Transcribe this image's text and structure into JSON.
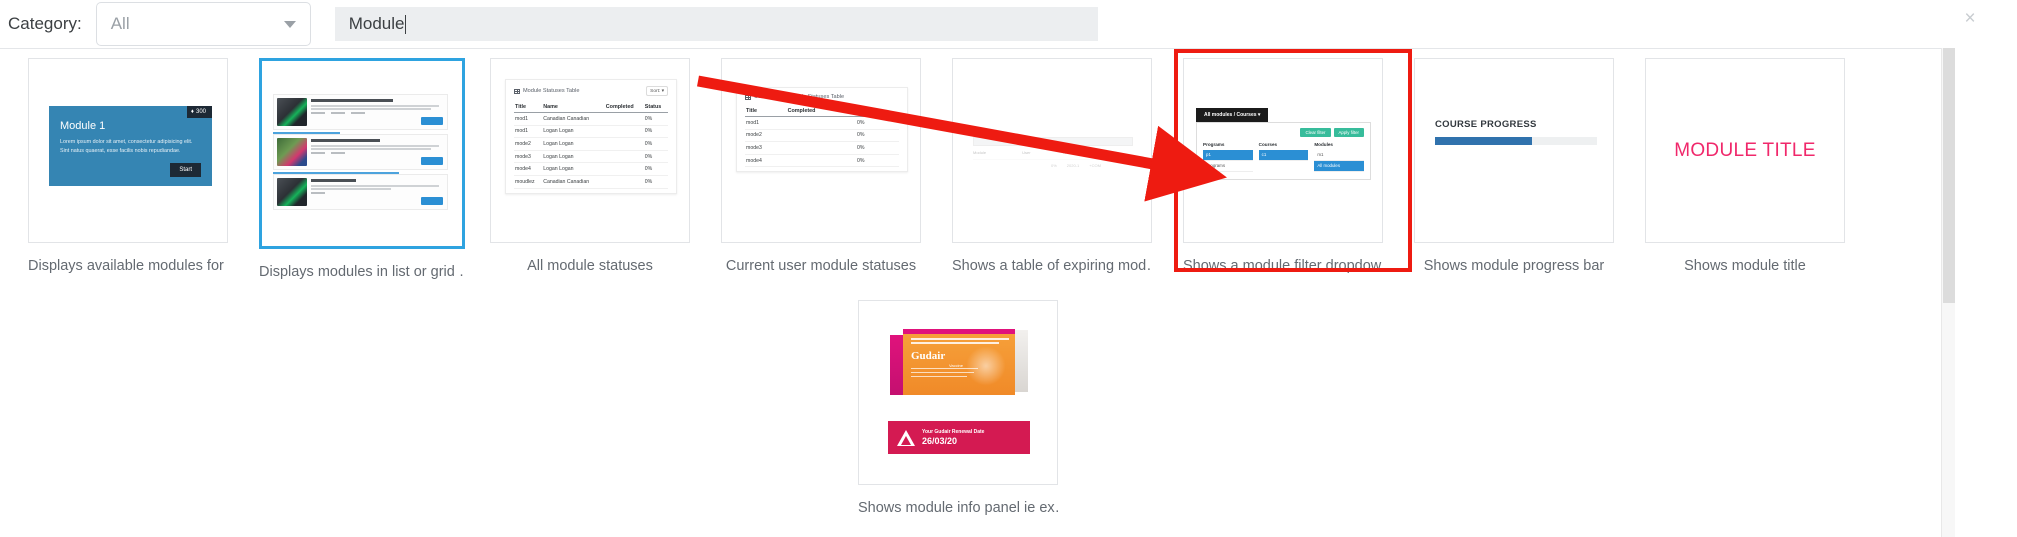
{
  "filter_bar": {
    "category_label": "Category:",
    "category_value": "All",
    "category_options": [
      "All"
    ],
    "search_value": "Module",
    "search_placeholder": "",
    "close_label": "×",
    "caret_icon": "chevron-down-icon"
  },
  "cards": [
    {
      "id": "available-modules",
      "caption": "Displays available modules for …",
      "selected": false,
      "highlighted": false,
      "preview": {
        "kind": "module-hero",
        "title": "Module 1",
        "badge": "300",
        "badge_icon": "gem-icon",
        "body": "Lorem ipsum dolor sit amet, consectetur adipisicing elit. Sint natus quaerat, esse facilis nobis repudiandae.",
        "button": "Start",
        "accent": "#3585b3"
      }
    },
    {
      "id": "modules-list-grid",
      "caption": "Displays modules in list or grid …",
      "selected": true,
      "highlighted": false,
      "preview": {
        "kind": "module-list",
        "items": [
          {
            "title": "My module is really awesome and you know it",
            "progress": 38,
            "button": "Start"
          },
          {
            "title": "My module is really awesome and you",
            "progress": 0,
            "button": "Resume"
          },
          {
            "title": "My module is really",
            "progress": 72,
            "button": "Resume"
          }
        ]
      }
    },
    {
      "id": "all-module-statuses",
      "caption": "All module statuses",
      "selected": false,
      "highlighted": false,
      "preview": {
        "kind": "table",
        "title": "Module Statuses Table",
        "title_icon": "table-icon",
        "sort_label": "Sort: ▾",
        "columns": [
          "Title",
          "Name",
          "Completed",
          "Status"
        ],
        "rows": [
          [
            "mod1",
            "Canadian Canadian",
            "",
            "0%"
          ],
          [
            "mod1",
            "Logan Logan",
            "",
            "0%"
          ],
          [
            "mode2",
            "Logan Logan",
            "",
            "0%"
          ],
          [
            "mode3",
            "Logan Logan",
            "",
            "0%"
          ],
          [
            "mode4",
            "Logan Logan",
            "",
            "0%"
          ],
          [
            "moudlez",
            "Canadian Canadian",
            "",
            "0%"
          ]
        ]
      }
    },
    {
      "id": "current-user-module-statuses",
      "caption": "Current user module statuses",
      "selected": false,
      "highlighted": false,
      "preview": {
        "kind": "table",
        "title": "Current User Module Statuses Table",
        "title_icon": "table-icon",
        "sort_label": "",
        "columns": [
          "Title",
          "Completed",
          "Status"
        ],
        "rows": [
          [
            "mod1",
            "",
            "0%"
          ],
          [
            "mode2",
            "",
            "0%"
          ],
          [
            "mode3",
            "",
            "0%"
          ],
          [
            "mode4",
            "",
            "0%"
          ]
        ]
      }
    },
    {
      "id": "expiring-modules-table",
      "caption": "Shows a table of expiring mod…",
      "selected": false,
      "highlighted": false,
      "preview": {
        "kind": "faint-table",
        "columns": [
          "Module",
          "User",
          "%",
          "Completed",
          "Expires"
        ],
        "rows": [
          [
            "",
            "",
            "0%",
            "2020-1",
            "+COM"
          ]
        ]
      }
    },
    {
      "id": "module-filter-dropdown",
      "caption": "Shows a module filter dropdow…",
      "selected": false,
      "highlighted": true,
      "preview": {
        "kind": "filter-dropdown",
        "tab_label": "All modules / Courses ▾",
        "buttons": [
          "Clear filter",
          "Apply filter"
        ],
        "columns": [
          {
            "label": "Programs",
            "options": [
              {
                "text": "p1",
                "selected": true
              },
              {
                "text": "Programs",
                "selected": false
              }
            ]
          },
          {
            "label": "Courses",
            "options": [
              {
                "text": "c1",
                "selected": true
              }
            ]
          },
          {
            "label": "Modules",
            "options": [
              {
                "text": "m1",
                "selected": false
              },
              {
                "text": "All modules",
                "selected": true
              }
            ]
          }
        ]
      }
    },
    {
      "id": "module-progress-bar",
      "caption": "Shows module progress bar",
      "selected": false,
      "highlighted": false,
      "preview": {
        "kind": "progress",
        "title": "COURSE PROGRESS",
        "percent": 60,
        "fill_color": "#3072ad",
        "track_color": "#eef0f1"
      }
    },
    {
      "id": "module-title",
      "caption": "Shows module title",
      "selected": false,
      "highlighted": false,
      "preview": {
        "kind": "title",
        "text": "MODULE TITLE",
        "color": "#f0286b"
      }
    },
    {
      "id": "module-info-panel",
      "caption": "Shows module info panel ie ex…",
      "selected": false,
      "highlighted": false,
      "preview": {
        "kind": "info-panel",
        "product_brand": "Gudair",
        "product_line1": "READ SAFETY DIRECTIONS",
        "product_line2": "FOR ANIMAL TREATMENT ONLY",
        "product_sub": "Vaccine",
        "alert_icon": "warning-triangle-icon",
        "alert_title": "Your Gudair Renewal Date",
        "alert_date": "26/03/20",
        "alert_color": "#d41a52"
      }
    }
  ],
  "annotation": {
    "arrow_color": "#ee1b11",
    "highlight_color": "#ee1b11",
    "selection_color": "#2ea3e0"
  }
}
